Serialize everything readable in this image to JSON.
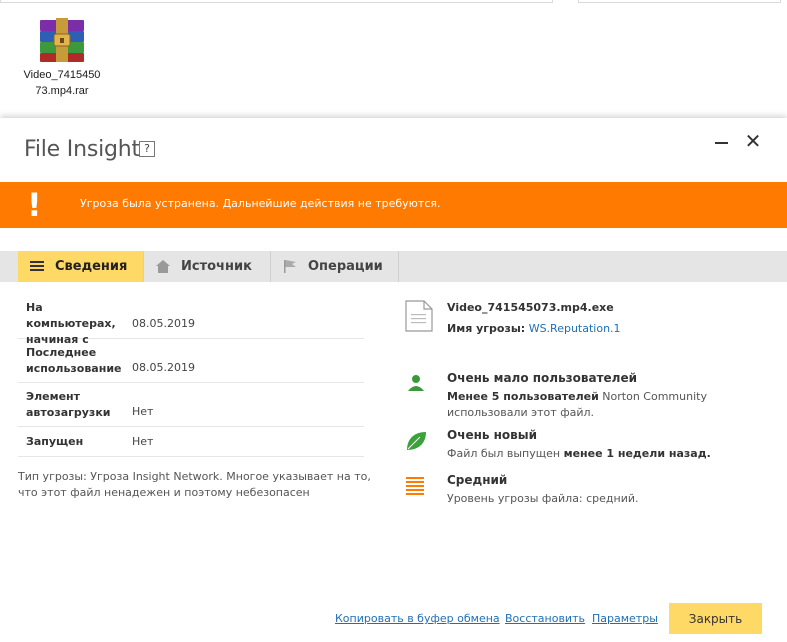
{
  "explorer": {
    "file_label": "Video_741545073.mp4.rar"
  },
  "dialog": {
    "title": "File Insight",
    "help": "?",
    "close_symbol": "✕",
    "banner": {
      "icon": "!",
      "text": "Угроза была устранена. Дальнейшие действия не требуются.",
      "color": "#ff7a00"
    },
    "tabs": [
      {
        "label": "Сведения",
        "icon": "list-icon",
        "active": true
      },
      {
        "label": "Источник",
        "icon": "home-icon",
        "active": false
      },
      {
        "label": "Операции",
        "icon": "flag-icon",
        "active": false
      }
    ],
    "details": [
      {
        "key": "На компьютерах, начиная с",
        "value": "08.05.2019"
      },
      {
        "key": "Последнее использование",
        "value": "08.05.2019"
      },
      {
        "key": "Элемент автозагрузки",
        "value": "Нет"
      },
      {
        "key": "Запущен",
        "value": "Нет"
      }
    ],
    "note": "Тип угрозы: Угроза Insight Network. Многое указывает на то, что этот файл ненадежен и поэтому небезопасен",
    "file": {
      "name": "Video_741545073.mp4.exe",
      "threat_label": "Имя угрозы:",
      "threat_name": "WS.Reputation.1"
    },
    "info": [
      {
        "icon": "user-icon",
        "heading": "Очень мало пользователей",
        "line1_bold": "Менее 5 пользователей",
        "line1_rest": " Norton Community",
        "line2": "использовали этот файл."
      },
      {
        "icon": "leaf-icon",
        "heading": "Очень новый",
        "line1_pre": "Файл был выпущен ",
        "line1_bold": "менее 1 недели назад."
      },
      {
        "icon": "level-icon",
        "heading": "Средний",
        "line1": "Уровень угрозы файла: средний."
      }
    ],
    "footer": {
      "copy_link": "Копировать в буфер обмена",
      "restore_link": "Восстановить",
      "params_link": "Параметры",
      "close_button": "Закрыть"
    }
  }
}
